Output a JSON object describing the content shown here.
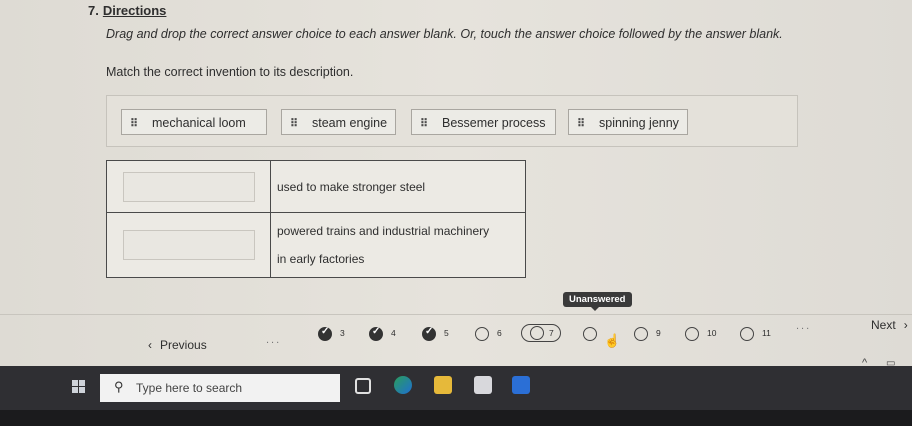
{
  "question": {
    "number": "7.",
    "label": "Directions"
  },
  "directions": "Drag and drop the correct answer choice to each answer blank. Or, touch the answer choice followed by the answer blank.",
  "instruction": "Match the correct invention to its description.",
  "choices": [
    {
      "label": "mechanical loom",
      "icon": "drag-handle-icon"
    },
    {
      "label": "steam engine",
      "icon": "drag-handle-icon"
    },
    {
      "label": "Bessemer process",
      "icon": "drag-handle-icon"
    },
    {
      "label": "spinning jenny",
      "icon": "drag-handle-icon"
    }
  ],
  "rows": [
    {
      "description": "used to make stronger steel"
    },
    {
      "description_line1": "powered trains and industrial machinery",
      "description_line2": "in early factories"
    }
  ],
  "tooltip": "Unanswered",
  "nav": {
    "previous_label": "Previous",
    "next_label": "Next",
    "ellipsis": "...",
    "questions": [
      {
        "number": "3",
        "state": "answered"
      },
      {
        "number": "4",
        "state": "answered"
      },
      {
        "number": "5",
        "state": "answered"
      },
      {
        "number": "6",
        "state": "unanswered"
      },
      {
        "number": "7",
        "state": "current"
      },
      {
        "number": "8",
        "state": "unanswered"
      },
      {
        "number": "9",
        "state": "unanswered"
      },
      {
        "number": "10",
        "state": "unanswered"
      },
      {
        "number": "11",
        "state": "unanswered"
      }
    ]
  },
  "taskbar": {
    "search_placeholder": "Type here to search",
    "apps": [
      "task-view-icon",
      "edge-icon",
      "file-explorer-icon",
      "store-icon",
      "mail-icon"
    ]
  }
}
